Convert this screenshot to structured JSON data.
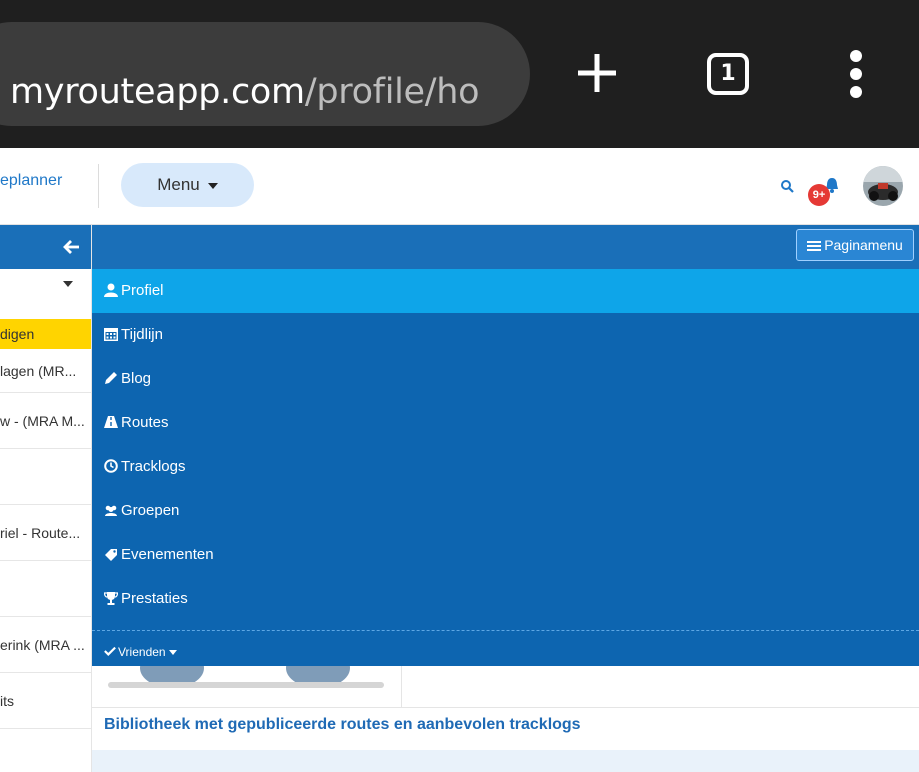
{
  "browser": {
    "url_host": "myrouteapp.com",
    "url_path": "/profile/ho",
    "tab_count": "1"
  },
  "header": {
    "brand_partial": "eplanner",
    "menu_label": "Menu",
    "notification_badge": "9+"
  },
  "sidebar": {
    "items": [
      {
        "label": "digen"
      },
      {
        "label": "lagen (MR..."
      },
      {
        "label": "w - (MRA M..."
      },
      {
        "label": ""
      },
      {
        "label": "riel - Route..."
      },
      {
        "label": ""
      },
      {
        "label": "erink (MRA ..."
      },
      {
        "label": "its"
      }
    ]
  },
  "page_menu": {
    "label": "Paginamenu",
    "items": [
      {
        "label": "Profiel",
        "icon": "user-icon"
      },
      {
        "label": "Tijdlijn",
        "icon": "calendar-icon"
      },
      {
        "label": "Blog",
        "icon": "pencil-icon"
      },
      {
        "label": "Routes",
        "icon": "road-icon"
      },
      {
        "label": "Tracklogs",
        "icon": "clock-icon"
      },
      {
        "label": "Groepen",
        "icon": "users-icon"
      },
      {
        "label": "Evenementen",
        "icon": "tag-icon"
      },
      {
        "label": "Prestaties",
        "icon": "trophy-icon"
      }
    ],
    "friends_label": "Vrienden"
  },
  "main": {
    "library_title": "Bibliotheek met gepubliceerde routes en aanbevolen tracklogs"
  },
  "colors": {
    "browser_bg": "#1f1f1f",
    "menu_blue": "#0d65b0",
    "active_item": "#0ea5e9",
    "highlight_yellow": "#ffd400",
    "link_blue": "#1f6ab5"
  }
}
